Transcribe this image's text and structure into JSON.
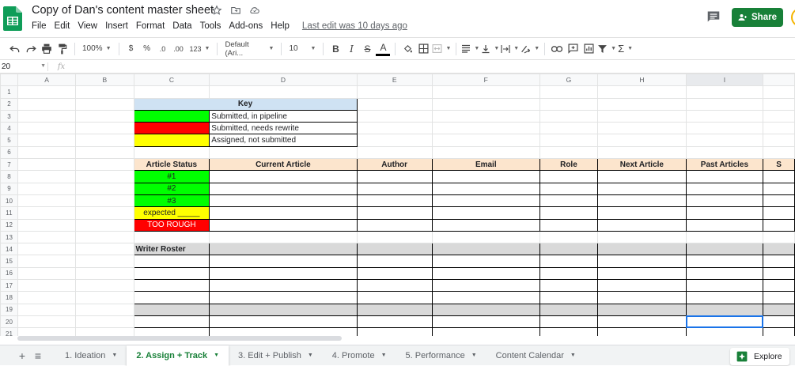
{
  "app": {
    "doc_title": "Copy of Dan's content master sheet",
    "menus": [
      "File",
      "Edit",
      "View",
      "Insert",
      "Format",
      "Data",
      "Tools",
      "Add-ons",
      "Help"
    ],
    "last_edit": "Last edit was 10 days ago",
    "share_label": "Share"
  },
  "toolbar": {
    "zoom": "100%",
    "currency": "$",
    "percent": "%",
    "dec_decrease": ".0",
    "dec_increase": ".00",
    "more_formats": "123",
    "font": "Default (Ari...",
    "font_size": "10",
    "bold": "B",
    "italic": "I",
    "strike": "S",
    "text_color": "A"
  },
  "formula_bar": {
    "cell_ref": "20",
    "fx": "fx"
  },
  "columns": [
    "A",
    "B",
    "C",
    "D",
    "E",
    "F",
    "G",
    "H",
    "I",
    ""
  ],
  "sheet": {
    "key": {
      "header": "Key",
      "rows": [
        "Submitted, in pipeline",
        "Submitted, needs rewrite",
        "Assigned, not submitted"
      ]
    },
    "status_table": {
      "headers": [
        "Article Status",
        "Current Article",
        "Author",
        "Email",
        "Role",
        "Next Article",
        "Past Articles",
        "S"
      ],
      "status_values": [
        "#1",
        "#2",
        "#3",
        "expected _____",
        "TOO ROUGH"
      ]
    },
    "writer_roster": "Writer Roster"
  },
  "tabs": [
    {
      "label": "1. Ideation",
      "active": false
    },
    {
      "label": "2. Assign + Track",
      "active": true
    },
    {
      "label": "3. Edit + Publish",
      "active": false
    },
    {
      "label": "4. Promote",
      "active": false
    },
    {
      "label": "5. Performance",
      "active": false
    },
    {
      "label": "Content Calendar",
      "active": false
    }
  ],
  "explore_label": "Explore",
  "colors": {
    "green_status": "#00ff00",
    "red_status": "#ff0000",
    "yellow_status": "#ffff00",
    "key_header": "#cfe2f3",
    "table_header": "#fce5cd",
    "section_grey": "#d9d9d9",
    "brand_green": "#188038"
  }
}
